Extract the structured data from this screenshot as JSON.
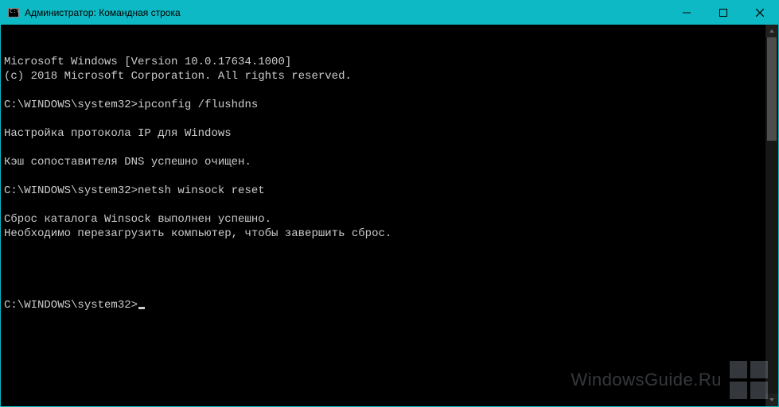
{
  "titlebar": {
    "title": "Администратор: Командная строка"
  },
  "console": {
    "lines": [
      "Microsoft Windows [Version 10.0.17634.1000]",
      "(c) 2018 Microsoft Corporation. All rights reserved.",
      "",
      "C:\\WINDOWS\\system32>ipconfig /flushdns",
      "",
      "Настройка протокола IP для Windows",
      "",
      "Кэш сопоставителя DNS успешно очищен.",
      "",
      "C:\\WINDOWS\\system32>netsh winsock reset",
      "",
      "Сброс каталога Winsock выполнен успешно.",
      "Необходимо перезагрузить компьютер, чтобы завершить сброс.",
      "",
      ""
    ],
    "prompt": "C:\\WINDOWS\\system32>"
  },
  "watermark": {
    "text": "WindowsGuide.Ru"
  }
}
